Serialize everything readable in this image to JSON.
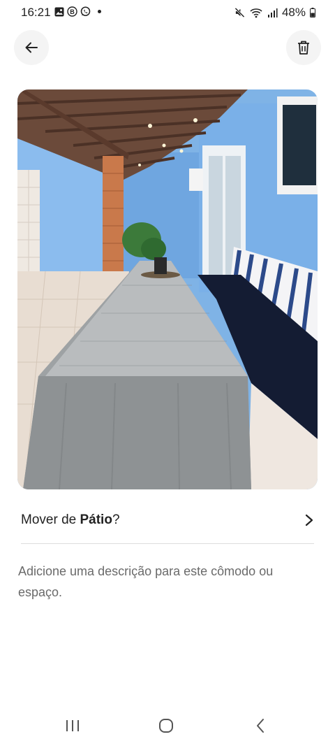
{
  "status_bar": {
    "time": "16:21",
    "battery": "48%",
    "left_icons": [
      "gallery-icon",
      "b-badge-icon",
      "whatsapp-icon"
    ],
    "right_icons": [
      "mute-icon",
      "wifi-icon",
      "signal-icon",
      "battery-icon"
    ]
  },
  "header": {
    "back_icon": "arrow-left-icon",
    "delete_icon": "trash-icon"
  },
  "photo": {
    "alt": "Pátio"
  },
  "move": {
    "prefix": "Mover de ",
    "room": "Pátio",
    "suffix": "?"
  },
  "description": {
    "placeholder": "Adicione uma descrição para este cômodo ou espaço."
  },
  "nav": {
    "icons": [
      "recents-icon",
      "home-icon",
      "back-icon"
    ]
  },
  "colors": {
    "accent_text": "#222222",
    "muted_text": "#6a6a6a",
    "divider": "#dddddd"
  }
}
